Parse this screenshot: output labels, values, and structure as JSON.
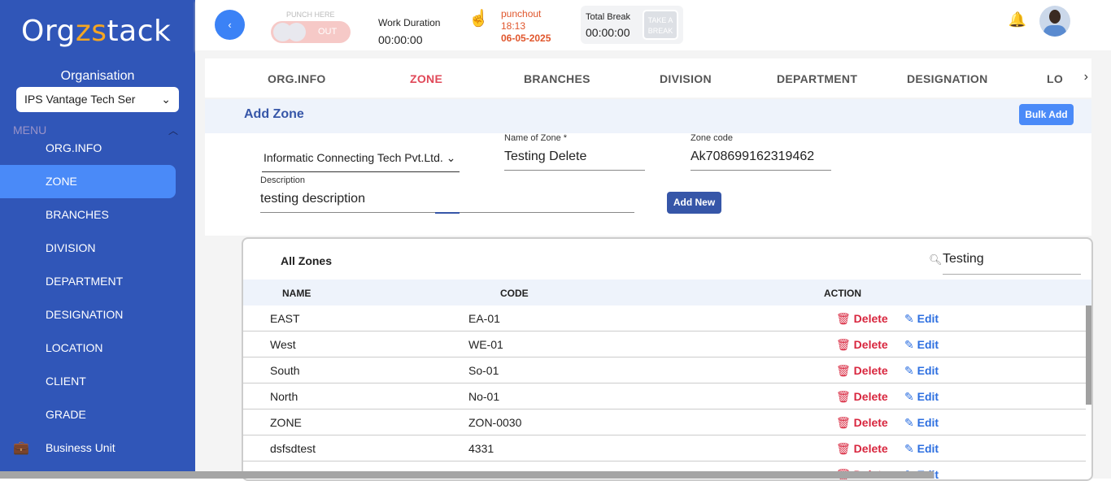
{
  "sidebar": {
    "logo_pre": "Org",
    "logo_mid": "zs",
    "logo_post": "tack",
    "org_label": "Organisation",
    "org_value": "IPS Vantage Tech Ser",
    "menu": "MENU",
    "items": [
      {
        "label": "ORG.INFO"
      },
      {
        "label": "ZONE"
      },
      {
        "label": "BRANCHES"
      },
      {
        "label": "DIVISION"
      },
      {
        "label": "DEPARTMENT"
      },
      {
        "label": "DESIGNATION"
      },
      {
        "label": "LOCATION"
      },
      {
        "label": "CLIENT"
      },
      {
        "label": "GRADE"
      },
      {
        "label": "Business Unit"
      }
    ]
  },
  "header": {
    "back": "‹",
    "punch_label": "PUNCH HERE",
    "punch_state": "OUT",
    "work_label": "Work Duration",
    "work_value": "00:00:00",
    "punch_status": "punchout",
    "punch_time": "18:13",
    "punch_date": "06-05-2025",
    "break_label": "Total Break",
    "break_value": "00:00:00",
    "take_break": "TAKE A BREAK"
  },
  "tabs": [
    "ORG.INFO",
    "ZONE",
    "BRANCHES",
    "DIVISION",
    "DEPARTMENT",
    "DESIGNATION",
    "LO"
  ],
  "form": {
    "title": "Add Zone",
    "bulk": "Bulk Add",
    "company": "Informatic Connecting Tech Pvt.Ltd.",
    "name_label": "Name of Zone *",
    "name_value": "Testing Delete",
    "code_label": "Zone code",
    "code_value": "Ak708699162319462",
    "desc_label": "Description",
    "desc_value": "testing description",
    "add_new": "Add New"
  },
  "table": {
    "title": "All Zones",
    "search": "Testing",
    "columns": [
      "NAME",
      "CODE",
      "ACTION"
    ],
    "delete": "Delete",
    "edit": "Edit",
    "rows": [
      {
        "name": "EAST",
        "code": "EA-01"
      },
      {
        "name": "West",
        "code": "WE-01"
      },
      {
        "name": "South",
        "code": "So-01"
      },
      {
        "name": "North",
        "code": "No-01"
      },
      {
        "name": "ZONE",
        "code": "ZON-0030"
      },
      {
        "name": "dsfsdtest",
        "code": "4331"
      }
    ]
  }
}
